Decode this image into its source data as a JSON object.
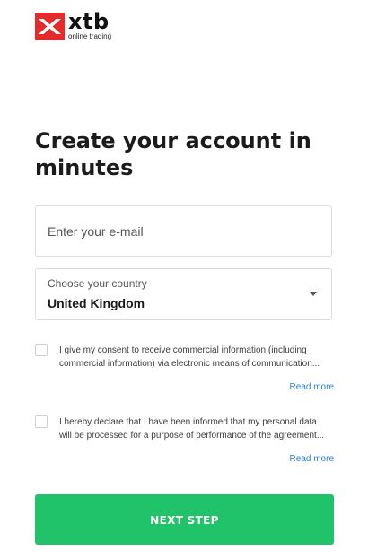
{
  "brand": {
    "name": "xtb",
    "tagline": "online trading",
    "color": "#e42a2a",
    "icon": "xtb-x-logo-icon"
  },
  "heading": "Create your account in minutes",
  "email": {
    "placeholder": "Enter your e-mail",
    "value": ""
  },
  "country": {
    "label": "Choose your country",
    "selected": "United Kingdom",
    "icon": "caret-down-icon"
  },
  "consents": [
    {
      "text": "I give my consent to receive commercial information (including commercial information) via electronic means of communication...",
      "checked": false,
      "read_more": "Read more"
    },
    {
      "text": "I hereby declare that I have been informed that my personal data will be processed for a purpose of performance of the agreement...",
      "checked": false,
      "read_more": "Read more"
    }
  ],
  "next_button": {
    "label": "NEXT STEP",
    "color": "#20c26a"
  },
  "colors": {
    "link": "#2f7fd6",
    "border": "#dcdcdc"
  }
}
